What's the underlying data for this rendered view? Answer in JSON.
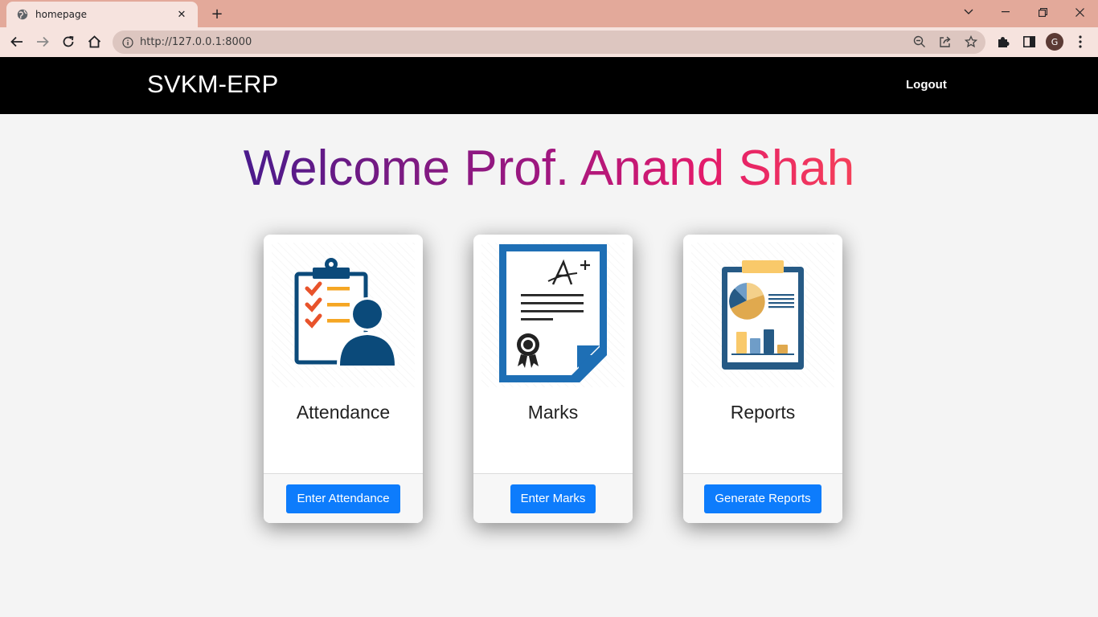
{
  "browser": {
    "tab_title": "homepage",
    "url": "http://127.0.0.1:8000",
    "profile_initial": "G"
  },
  "navbar": {
    "brand": "SVKM-ERP",
    "logout_label": "Logout"
  },
  "welcome": {
    "text": "Welcome Prof. Anand Shah"
  },
  "cards": [
    {
      "title": "Attendance",
      "button_label": "Enter Attendance",
      "icon": "clipboard-checklist-person-icon"
    },
    {
      "title": "Marks",
      "button_label": "Enter Marks",
      "icon": "graded-certificate-icon"
    },
    {
      "title": "Reports",
      "button_label": "Generate Reports",
      "icon": "clipboard-charts-report-icon"
    }
  ],
  "colors": {
    "navbar_bg": "#000000",
    "button_bg": "#0d7cfc",
    "tabbar_bg": "#e3a99a",
    "welcome_gradient_start": "#4a1a8c",
    "welcome_gradient_end": "#f5405a"
  }
}
